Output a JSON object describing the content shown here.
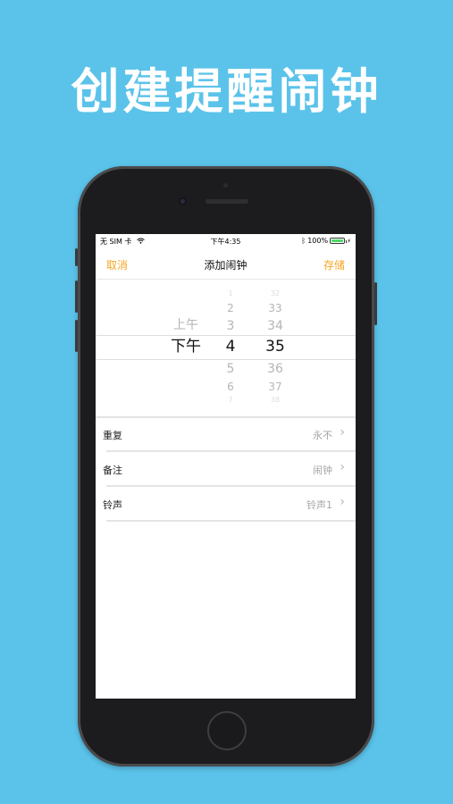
{
  "headline": "创建提醒闹钟",
  "status": {
    "carrier": "无 SIM 卡",
    "time": "下午4:35",
    "battery": "100%",
    "battery_level": 1.0
  },
  "nav": {
    "cancel": "取消",
    "title": "添加闹钟",
    "save": "存储"
  },
  "picker": {
    "ampm": {
      "above": "上午",
      "selected": "下午"
    },
    "hour": {
      "above": [
        "1",
        "2",
        "3"
      ],
      "selected": "4",
      "below": [
        "5",
        "6",
        "7"
      ]
    },
    "minute": {
      "above": [
        "32",
        "33",
        "34"
      ],
      "selected": "35",
      "below": [
        "36",
        "37",
        "38"
      ]
    }
  },
  "rows": [
    {
      "label": "重复",
      "value": "永不"
    },
    {
      "label": "备注",
      "value": "闹钟"
    },
    {
      "label": "铃声",
      "value": "铃声1"
    }
  ],
  "colors": {
    "background": "#5bc3ea",
    "accent": "#f5a623",
    "battery": "#4cd964"
  }
}
